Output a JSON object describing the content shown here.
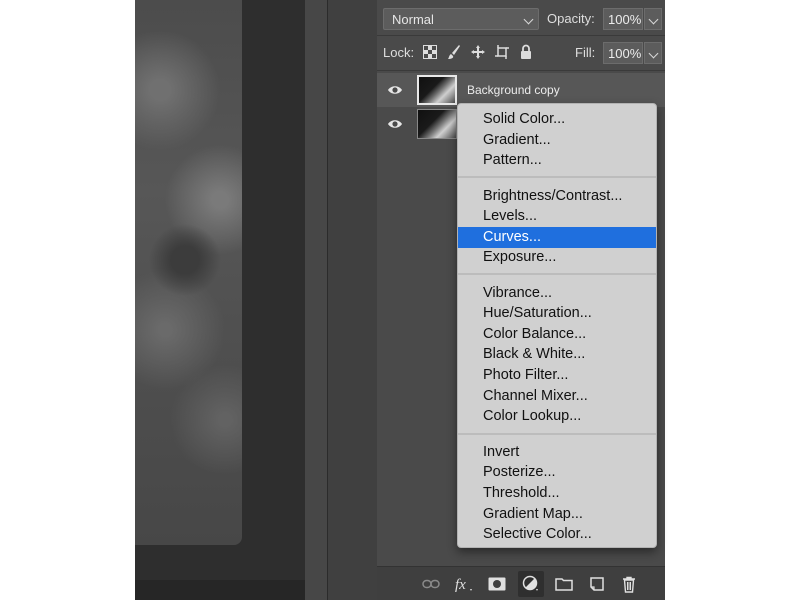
{
  "layers_panel": {
    "blend_mode": "Normal",
    "opacity_label": "Opacity:",
    "opacity_value": "100%",
    "lock_label": "Lock:",
    "fill_label": "Fill:",
    "fill_value": "100%",
    "layers": [
      {
        "name": "Background copy",
        "visible": true,
        "selected": true
      },
      {
        "name": "",
        "visible": true,
        "selected": false
      }
    ],
    "footer_icons": [
      "link-icon",
      "fx-icon",
      "mask-icon",
      "adjustment-layer-icon",
      "folder-icon",
      "new-layer-icon",
      "trash-icon"
    ]
  },
  "adjustment_menu": {
    "groups": [
      [
        "Solid Color...",
        "Gradient...",
        "Pattern..."
      ],
      [
        "Brightness/Contrast...",
        "Levels...",
        "Curves...",
        "Exposure..."
      ],
      [
        "Vibrance...",
        "Hue/Saturation...",
        "Color Balance...",
        "Black & White...",
        "Photo Filter...",
        "Channel Mixer...",
        "Color Lookup..."
      ],
      [
        "Invert",
        "Posterize...",
        "Threshold...",
        "Gradient Map...",
        "Selective Color..."
      ]
    ],
    "highlighted": "Curves..."
  },
  "colors": {
    "highlight": "#1f6fde",
    "panel_bg": "#4a4a4a",
    "menu_bg": "#d0d0d0"
  }
}
